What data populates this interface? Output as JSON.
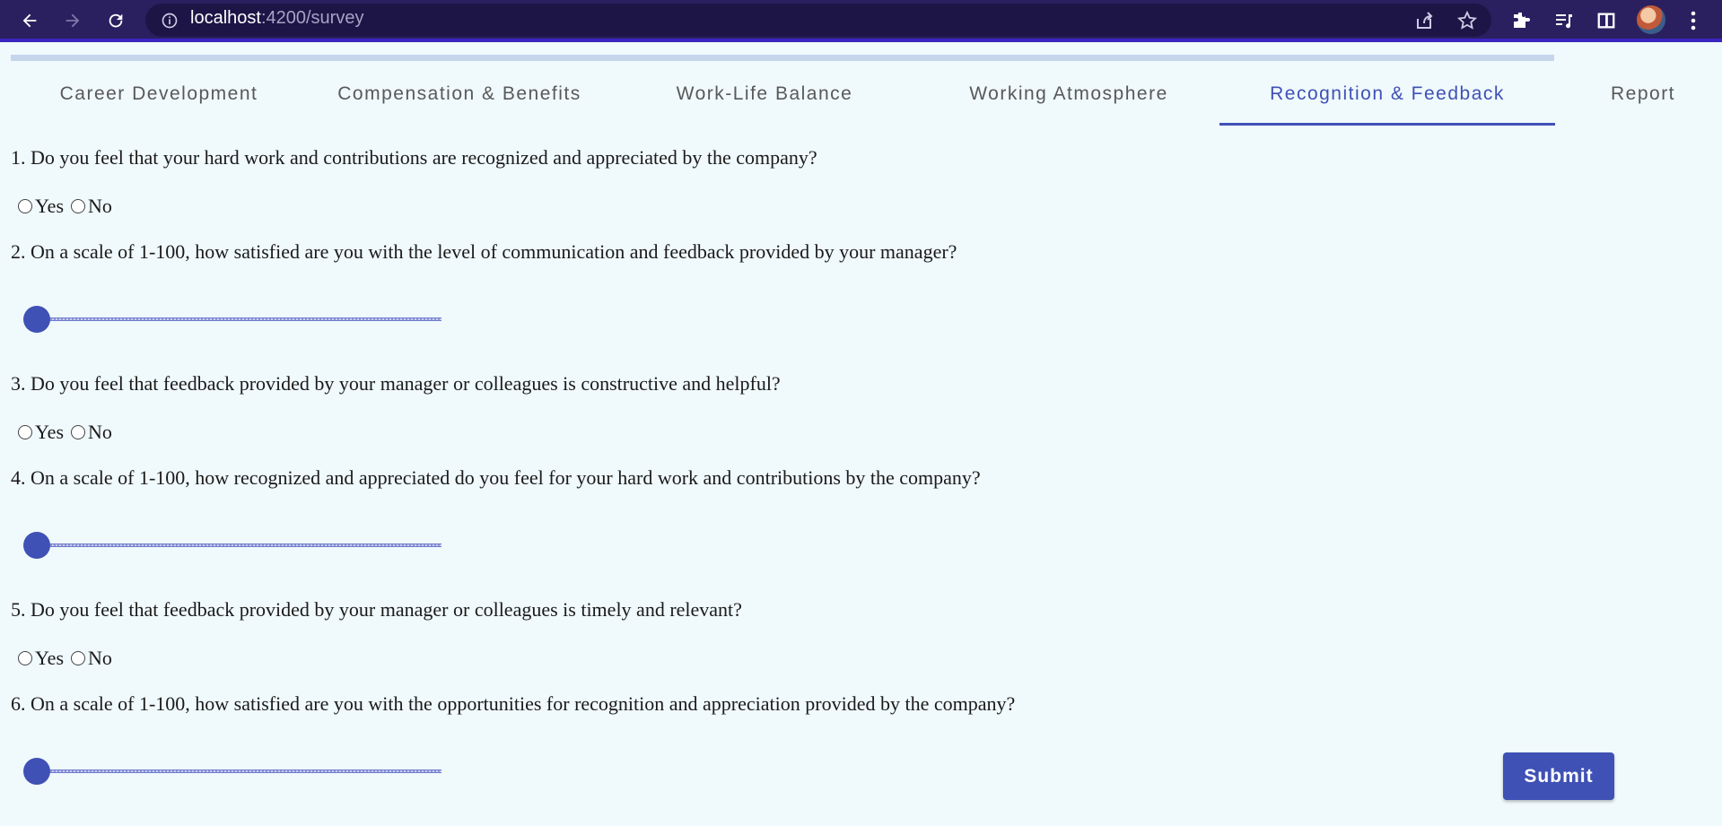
{
  "browser": {
    "url_host": "localhost",
    "url_path": ":4200/survey",
    "icons": [
      "back-arrow-icon",
      "forward-arrow-icon",
      "reload-icon",
      "info-icon",
      "share-icon",
      "star-icon",
      "extensions-icon",
      "media-queue-icon",
      "side-panel-icon",
      "profile-avatar",
      "more-vert-icon"
    ]
  },
  "colors": {
    "accent": "#3f51b5",
    "chrome": "#2a2060",
    "background": "#f0f9fc"
  },
  "tabs": [
    {
      "label": "Career Development",
      "active": false
    },
    {
      "label": "Compensation & Benefits",
      "active": false
    },
    {
      "label": "Work-Life Balance",
      "active": false
    },
    {
      "label": "Working Atmosphere",
      "active": false
    },
    {
      "label": "Recognition & Feedback",
      "active": true
    },
    {
      "label": "Report",
      "active": false
    }
  ],
  "questions": [
    {
      "text": "1. Do you feel that your hard work and contributions are recognized and appreciated by the company?",
      "type": "yesno",
      "options": [
        "Yes",
        "No"
      ]
    },
    {
      "text": "2. On a scale of 1-100, how satisfied are you with the level of communication and feedback provided by your manager?",
      "type": "slider",
      "value": 1
    },
    {
      "text": "3. Do you feel that feedback provided by your manager or colleagues is constructive and helpful?",
      "type": "yesno",
      "options": [
        "Yes",
        "No"
      ]
    },
    {
      "text": "4. On a scale of 1-100, how recognized and appreciated do you feel for your hard work and contributions by the company?",
      "type": "slider",
      "value": 1
    },
    {
      "text": "5. Do you feel that feedback provided by your manager or colleagues is timely and relevant?",
      "type": "yesno",
      "options": [
        "Yes",
        "No"
      ]
    },
    {
      "text": "6. On a scale of 1-100, how satisfied are you with the opportunities for recognition and appreciation provided by the company?",
      "type": "slider",
      "value": 1
    }
  ],
  "submit_label": "Submit"
}
